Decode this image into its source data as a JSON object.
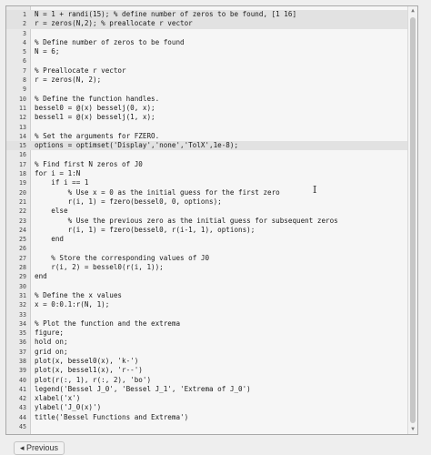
{
  "editor": {
    "lines": [
      {
        "num": "1",
        "text": "N = 1 + randi(15); % define number of zeros to be found, [1 16]"
      },
      {
        "num": "2",
        "text": "r = zeros(N,2); % preallocate r vector"
      },
      {
        "num": "3",
        "text": ""
      },
      {
        "num": "4",
        "text": "% Define number of zeros to be found"
      },
      {
        "num": "5",
        "text": "N = 6;"
      },
      {
        "num": "6",
        "text": ""
      },
      {
        "num": "7",
        "text": "% Preallocate r vector"
      },
      {
        "num": "8",
        "text": "r = zeros(N, 2);"
      },
      {
        "num": "9",
        "text": ""
      },
      {
        "num": "10",
        "text": "% Define the function handles."
      },
      {
        "num": "11",
        "text": "bessel0 = @(x) besselj(0, x);"
      },
      {
        "num": "12",
        "text": "bessel1 = @(x) besselj(1, x);"
      },
      {
        "num": "13",
        "text": ""
      },
      {
        "num": "14",
        "text": "% Set the arguments for FZERO."
      },
      {
        "num": "15",
        "text": "options = optimset('Display','none','TolX',1e-8);"
      },
      {
        "num": "16",
        "text": ""
      },
      {
        "num": "17",
        "text": "% Find first N zeros of J0"
      },
      {
        "num": "18",
        "text": "for i = 1:N"
      },
      {
        "num": "19",
        "text": "    if i == 1"
      },
      {
        "num": "20",
        "text": "        % Use x = 0 as the initial guess for the first zero"
      },
      {
        "num": "21",
        "text": "        r(i, 1) = fzero(bessel0, 0, options);"
      },
      {
        "num": "22",
        "text": "    else"
      },
      {
        "num": "23",
        "text": "        % Use the previous zero as the initial guess for subsequent zeros"
      },
      {
        "num": "24",
        "text": "        r(i, 1) = fzero(bessel0, r(i-1, 1), options);"
      },
      {
        "num": "25",
        "text": "    end"
      },
      {
        "num": "26",
        "text": ""
      },
      {
        "num": "27",
        "text": "    % Store the corresponding values of J0"
      },
      {
        "num": "28",
        "text": "    r(i, 2) = bessel0(r(i, 1));"
      },
      {
        "num": "29",
        "text": "end"
      },
      {
        "num": "30",
        "text": ""
      },
      {
        "num": "31",
        "text": "% Define the x values"
      },
      {
        "num": "32",
        "text": "x = 0:0.1:r(N, 1);"
      },
      {
        "num": "33",
        "text": ""
      },
      {
        "num": "34",
        "text": "% Plot the function and the extrema"
      },
      {
        "num": "35",
        "text": "figure;"
      },
      {
        "num": "36",
        "text": "hold on;"
      },
      {
        "num": "37",
        "text": "grid on;"
      },
      {
        "num": "38",
        "text": "plot(x, bessel0(x), 'k-')"
      },
      {
        "num": "39",
        "text": "plot(x, bessel1(x), 'r--')"
      },
      {
        "num": "40",
        "text": "plot(r(:, 1), r(:, 2), 'bo')"
      },
      {
        "num": "41",
        "text": "legend('Bessel J_0', 'Bessel J_1', 'Extrema of J_0')"
      },
      {
        "num": "42",
        "text": "xlabel('x')"
      },
      {
        "num": "43",
        "text": "ylabel('J_0(x)')"
      },
      {
        "num": "44",
        "text": "title('Bessel Functions and Extrema')"
      },
      {
        "num": "45",
        "text": ""
      }
    ]
  },
  "highlighted_lines": [
    "1",
    "2",
    "15"
  ],
  "nav": {
    "previous_label": "◂ Previous"
  },
  "icons": {
    "cursor": "text-cursor-icon"
  },
  "colors": {
    "editor_bg": "#f6f6f6",
    "gutter_bg": "#e9e9e9",
    "highlight": "#e2e2e2"
  }
}
